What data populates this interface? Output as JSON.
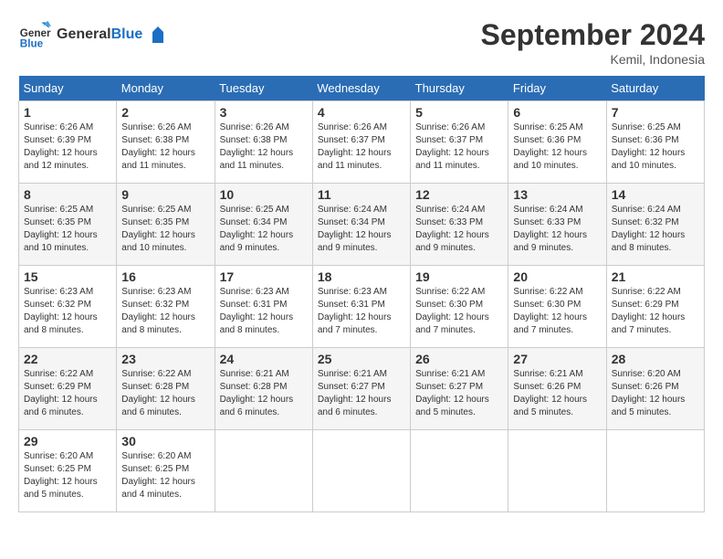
{
  "header": {
    "logo_line1": "General",
    "logo_line2": "Blue",
    "month": "September 2024",
    "location": "Kemil, Indonesia"
  },
  "days_of_week": [
    "Sunday",
    "Monday",
    "Tuesday",
    "Wednesday",
    "Thursday",
    "Friday",
    "Saturday"
  ],
  "weeks": [
    [
      {
        "num": "1",
        "info": "Sunrise: 6:26 AM\nSunset: 6:39 PM\nDaylight: 12 hours\nand 12 minutes."
      },
      {
        "num": "2",
        "info": "Sunrise: 6:26 AM\nSunset: 6:38 PM\nDaylight: 12 hours\nand 11 minutes."
      },
      {
        "num": "3",
        "info": "Sunrise: 6:26 AM\nSunset: 6:38 PM\nDaylight: 12 hours\nand 11 minutes."
      },
      {
        "num": "4",
        "info": "Sunrise: 6:26 AM\nSunset: 6:37 PM\nDaylight: 12 hours\nand 11 minutes."
      },
      {
        "num": "5",
        "info": "Sunrise: 6:26 AM\nSunset: 6:37 PM\nDaylight: 12 hours\nand 11 minutes."
      },
      {
        "num": "6",
        "info": "Sunrise: 6:25 AM\nSunset: 6:36 PM\nDaylight: 12 hours\nand 10 minutes."
      },
      {
        "num": "7",
        "info": "Sunrise: 6:25 AM\nSunset: 6:36 PM\nDaylight: 12 hours\nand 10 minutes."
      }
    ],
    [
      {
        "num": "8",
        "info": "Sunrise: 6:25 AM\nSunset: 6:35 PM\nDaylight: 12 hours\nand 10 minutes."
      },
      {
        "num": "9",
        "info": "Sunrise: 6:25 AM\nSunset: 6:35 PM\nDaylight: 12 hours\nand 10 minutes."
      },
      {
        "num": "10",
        "info": "Sunrise: 6:25 AM\nSunset: 6:34 PM\nDaylight: 12 hours\nand 9 minutes."
      },
      {
        "num": "11",
        "info": "Sunrise: 6:24 AM\nSunset: 6:34 PM\nDaylight: 12 hours\nand 9 minutes."
      },
      {
        "num": "12",
        "info": "Sunrise: 6:24 AM\nSunset: 6:33 PM\nDaylight: 12 hours\nand 9 minutes."
      },
      {
        "num": "13",
        "info": "Sunrise: 6:24 AM\nSunset: 6:33 PM\nDaylight: 12 hours\nand 9 minutes."
      },
      {
        "num": "14",
        "info": "Sunrise: 6:24 AM\nSunset: 6:32 PM\nDaylight: 12 hours\nand 8 minutes."
      }
    ],
    [
      {
        "num": "15",
        "info": "Sunrise: 6:23 AM\nSunset: 6:32 PM\nDaylight: 12 hours\nand 8 minutes."
      },
      {
        "num": "16",
        "info": "Sunrise: 6:23 AM\nSunset: 6:32 PM\nDaylight: 12 hours\nand 8 minutes."
      },
      {
        "num": "17",
        "info": "Sunrise: 6:23 AM\nSunset: 6:31 PM\nDaylight: 12 hours\nand 8 minutes."
      },
      {
        "num": "18",
        "info": "Sunrise: 6:23 AM\nSunset: 6:31 PM\nDaylight: 12 hours\nand 7 minutes."
      },
      {
        "num": "19",
        "info": "Sunrise: 6:22 AM\nSunset: 6:30 PM\nDaylight: 12 hours\nand 7 minutes."
      },
      {
        "num": "20",
        "info": "Sunrise: 6:22 AM\nSunset: 6:30 PM\nDaylight: 12 hours\nand 7 minutes."
      },
      {
        "num": "21",
        "info": "Sunrise: 6:22 AM\nSunset: 6:29 PM\nDaylight: 12 hours\nand 7 minutes."
      }
    ],
    [
      {
        "num": "22",
        "info": "Sunrise: 6:22 AM\nSunset: 6:29 PM\nDaylight: 12 hours\nand 6 minutes."
      },
      {
        "num": "23",
        "info": "Sunrise: 6:22 AM\nSunset: 6:28 PM\nDaylight: 12 hours\nand 6 minutes."
      },
      {
        "num": "24",
        "info": "Sunrise: 6:21 AM\nSunset: 6:28 PM\nDaylight: 12 hours\nand 6 minutes."
      },
      {
        "num": "25",
        "info": "Sunrise: 6:21 AM\nSunset: 6:27 PM\nDaylight: 12 hours\nand 6 minutes."
      },
      {
        "num": "26",
        "info": "Sunrise: 6:21 AM\nSunset: 6:27 PM\nDaylight: 12 hours\nand 5 minutes."
      },
      {
        "num": "27",
        "info": "Sunrise: 6:21 AM\nSunset: 6:26 PM\nDaylight: 12 hours\nand 5 minutes."
      },
      {
        "num": "28",
        "info": "Sunrise: 6:20 AM\nSunset: 6:26 PM\nDaylight: 12 hours\nand 5 minutes."
      }
    ],
    [
      {
        "num": "29",
        "info": "Sunrise: 6:20 AM\nSunset: 6:25 PM\nDaylight: 12 hours\nand 5 minutes."
      },
      {
        "num": "30",
        "info": "Sunrise: 6:20 AM\nSunset: 6:25 PM\nDaylight: 12 hours\nand 4 minutes."
      },
      {
        "num": "",
        "info": ""
      },
      {
        "num": "",
        "info": ""
      },
      {
        "num": "",
        "info": ""
      },
      {
        "num": "",
        "info": ""
      },
      {
        "num": "",
        "info": ""
      }
    ]
  ]
}
